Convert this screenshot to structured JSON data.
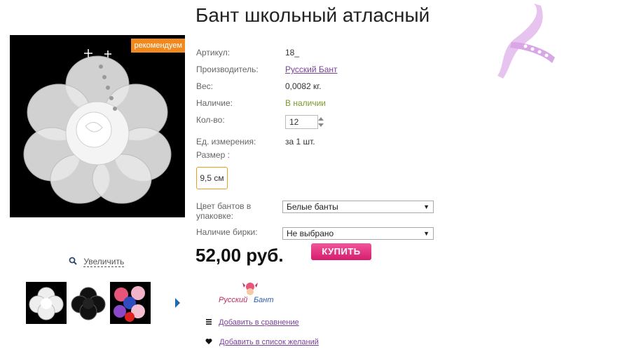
{
  "product": {
    "title": "Бант школьный атласный",
    "badge": "рекомендуем",
    "zoom_label": "Увеличить"
  },
  "specs": {
    "article_label": "Артикул:",
    "article_value": "18_",
    "maker_label": "Производитель:",
    "maker_value": "Русский Бант",
    "weight_label": "Вес:",
    "weight_value": "0,0082 кг.",
    "stock_label": "Наличие:",
    "stock_value": "В наличии",
    "qty_label": "Кол-во:",
    "qty_value": "12",
    "unit_label": "Ед. измерения:",
    "unit_value": "за 1 шт.",
    "size_label": "Размер :",
    "size_option": "9,5 см"
  },
  "options": {
    "color_label_line1": "Цвет бантов в",
    "color_label_line2": "упаковке:",
    "color_value": "Белые банты",
    "tag_label": "Наличие бирки:",
    "tag_value": "Не выбрано"
  },
  "purchase": {
    "price": "52,00 руб.",
    "buy_label": "КУПИТЬ"
  },
  "brand": {
    "logo_text_1": "Русский",
    "logo_text_2": "Бант"
  },
  "actions": {
    "compare_label": "Добавить в сравнение",
    "wishlist_label": "Добавить в список желаний"
  },
  "colors": {
    "accent_link": "#7a3f9c",
    "buy_button": "#e5317f",
    "badge": "#f08a1e",
    "in_stock": "#7a9a2a",
    "size_border": "#e2a11e"
  },
  "icons": {
    "zoom": "magnifier-icon",
    "compare": "list-icon",
    "wishlist": "heart-icon",
    "next": "arrow-right-icon"
  }
}
